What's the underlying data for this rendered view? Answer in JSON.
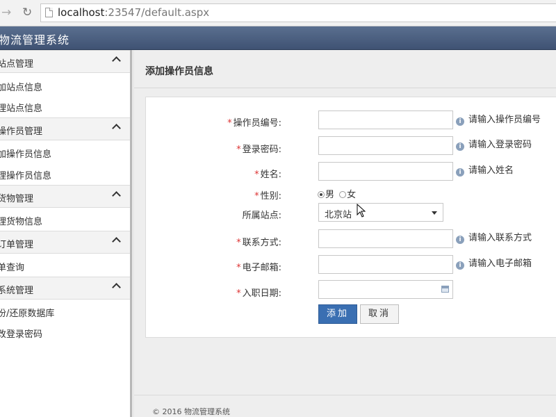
{
  "browser": {
    "back_icon": "back-arrow-icon",
    "refresh_icon": "refresh-icon",
    "url_host": "localhost",
    "url_rest": ":23547/default.aspx"
  },
  "app": {
    "title": "物流管理系统",
    "header_color": "#4a5d7f"
  },
  "sidebar": {
    "groups": [
      {
        "label": "站点管理",
        "items": [
          "加站点信息",
          "理站点信息"
        ]
      },
      {
        "label": "操作员管理",
        "items": [
          "加操作员信息",
          "理操作员信息"
        ]
      },
      {
        "label": "货物管理",
        "items": [
          "理货物信息"
        ]
      },
      {
        "label": "订单管理",
        "items": [
          "单查询"
        ]
      },
      {
        "label": "系统管理",
        "items": [
          "份/还原数据库",
          "改登录密码"
        ]
      }
    ]
  },
  "main": {
    "title": "添加操作员信息",
    "form": {
      "operator_id": {
        "label": "操作员编号:",
        "value": "",
        "hint": "请输入操作员编号"
      },
      "password": {
        "label": "登录密码:",
        "value": "",
        "hint": "请输入登录密码"
      },
      "name": {
        "label": "姓名:",
        "value": "",
        "hint": "请输入姓名"
      },
      "gender": {
        "label": "性别:",
        "options": [
          "男",
          "女"
        ],
        "selected": "男"
      },
      "station": {
        "label": "所属站点:",
        "value": "北京站"
      },
      "contact": {
        "label": "联系方式:",
        "value": "",
        "hint": "请输入联系方式"
      },
      "email": {
        "label": "电子邮箱:",
        "value": "",
        "hint": "请输入电子邮箱"
      },
      "hire_date": {
        "label": "入职日期:",
        "value": ""
      },
      "required_mark": "*",
      "info_glyph": "i",
      "add_button": "添加",
      "cancel_button": "取消"
    },
    "footer": "© 2016 物流管理系统",
    "accent_color": "#3a6fb2"
  }
}
